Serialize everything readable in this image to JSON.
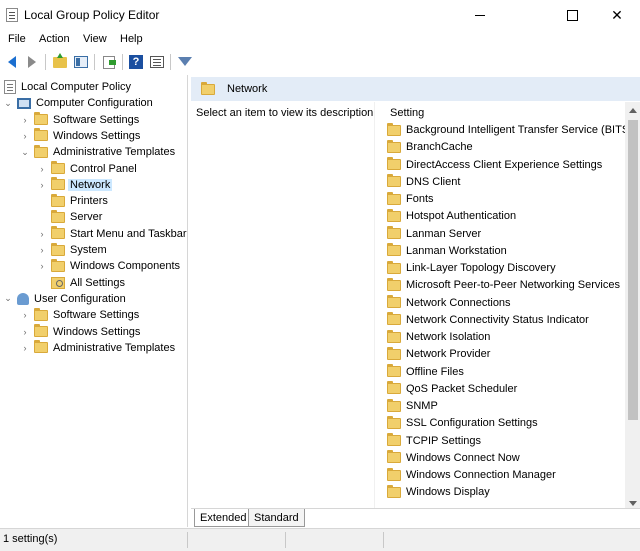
{
  "window": {
    "title": "Local Group Policy Editor",
    "close_glyph": "✕"
  },
  "menu": [
    "File",
    "Action",
    "View",
    "Help"
  ],
  "toolbar": {
    "help_glyph": "?"
  },
  "tree": [
    {
      "label": "Local Computer Policy",
      "icon": "doc-icon",
      "expander": "",
      "indent": 0
    },
    {
      "label": "Computer Configuration",
      "icon": "computer-icon",
      "expander": "⌄",
      "indent": 1
    },
    {
      "label": "Software Settings",
      "icon": "folder-icon",
      "expander": "›",
      "indent": 2
    },
    {
      "label": "Windows Settings",
      "icon": "folder-icon",
      "expander": "›",
      "indent": 2
    },
    {
      "label": "Administrative Templates",
      "icon": "folder-icon",
      "expander": "⌄",
      "indent": 2
    },
    {
      "label": "Control Panel",
      "icon": "folder-icon",
      "expander": "›",
      "indent": 3
    },
    {
      "label": "Network",
      "icon": "folder-icon",
      "expander": "›",
      "indent": 3,
      "selected": true
    },
    {
      "label": "Printers",
      "icon": "folder-icon",
      "expander": "",
      "indent": 3
    },
    {
      "label": "Server",
      "icon": "folder-icon",
      "expander": "",
      "indent": 3
    },
    {
      "label": "Start Menu and Taskbar",
      "icon": "folder-icon",
      "expander": "›",
      "indent": 3
    },
    {
      "label": "System",
      "icon": "folder-icon",
      "expander": "›",
      "indent": 3
    },
    {
      "label": "Windows Components",
      "icon": "folder-icon",
      "expander": "›",
      "indent": 3
    },
    {
      "label": "All Settings",
      "icon": "settings-folder-icon",
      "expander": "",
      "indent": 3
    },
    {
      "label": "User Configuration",
      "icon": "user-icon",
      "expander": "⌄",
      "indent": 1
    },
    {
      "label": "Software Settings",
      "icon": "folder-icon",
      "expander": "›",
      "indent": 2
    },
    {
      "label": "Windows Settings",
      "icon": "folder-icon",
      "expander": "›",
      "indent": 2
    },
    {
      "label": "Administrative Templates",
      "icon": "folder-icon",
      "expander": "›",
      "indent": 2
    }
  ],
  "content": {
    "header_title": "Network",
    "description": "Select an item to view its description.",
    "column_header": "Setting",
    "items": [
      "Background Intelligent Transfer Service (BITS)",
      "BranchCache",
      "DirectAccess Client Experience Settings",
      "DNS Client",
      "Fonts",
      "Hotspot Authentication",
      "Lanman Server",
      "Lanman Workstation",
      "Link-Layer Topology Discovery",
      "Microsoft Peer-to-Peer Networking Services",
      "Network Connections",
      "Network Connectivity Status Indicator",
      "Network Isolation",
      "Network Provider",
      "Offline Files",
      "QoS Packet Scheduler",
      "SNMP",
      "SSL Configuration Settings",
      "TCPIP Settings",
      "Windows Connect Now",
      "Windows Connection Manager",
      "Windows Display"
    ]
  },
  "tabs": {
    "extended": "Extended",
    "standard": "Standard"
  },
  "status": {
    "text": "1 setting(s)"
  },
  "colors": {
    "header_bg": "#e3ecf7",
    "selection": "#cce8ff",
    "folder": "#f1cf6b"
  }
}
